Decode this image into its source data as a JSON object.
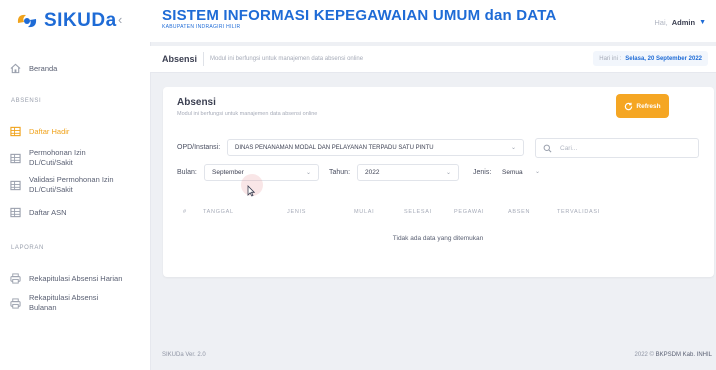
{
  "brand": {
    "logo_text": "SIKUDa",
    "collapse_icon": "chevron-left-icon"
  },
  "header": {
    "title": "SISTEM INFORMASI KEPEGAWAIAN UMUM dan DATA",
    "subtitle": "KABUPATEN INDRAGIRI HILIR",
    "user_greeting": "Hai,",
    "user_name": "Admin"
  },
  "sidebar": {
    "home": {
      "label": "Beranda",
      "icon": "home-icon"
    },
    "section_absensi": "ABSENSI",
    "absensi_items": [
      {
        "label": "Daftar Hadir",
        "icon": "table-icon",
        "active": true
      },
      {
        "label": "Permohonan Izin DL/Cuti/Sakit",
        "icon": "table-icon",
        "active": false
      },
      {
        "label": "Validasi Permohonan Izin DL/Cuti/Sakit",
        "icon": "table-icon",
        "active": false
      },
      {
        "label": "Daftar ASN",
        "icon": "table-icon",
        "active": false
      }
    ],
    "section_laporan": "LAPORAN",
    "laporan_items": [
      {
        "label": "Rekapitulasi Absensi Harian",
        "icon": "printer-icon"
      },
      {
        "label": "Rekapitulasi Absensi Bulanan",
        "icon": "printer-icon"
      }
    ]
  },
  "subheader": {
    "title": "Absensi",
    "description": "Modul ini berfungsi untuk manajemen data absensi online",
    "date_label": "Hari ini :",
    "date_value": "Selasa, 20 September 2022"
  },
  "card": {
    "title": "Absensi",
    "description": "Modul ini berfungsi untuk manajemen data absensi online",
    "refresh_label": "Refresh",
    "filters": {
      "opd_label": "OPD/Instansi:",
      "opd_value": "DINAS PENANAMAN MODAL DAN PELAYANAN TERPADU SATU PINTU",
      "search_placeholder": "Cari...",
      "bulan_label": "Bulan:",
      "bulan_value": "September",
      "tahun_label": "Tahun:",
      "tahun_value": "2022",
      "jenis_label": "Jenis:",
      "jenis_value": "Semua"
    },
    "table": {
      "columns": [
        "#",
        "TANGGAL",
        "JENIS",
        "MULAI",
        "SELESAI",
        "PEGAWAI",
        "ABSEN",
        "TERVALIDASI"
      ],
      "empty_text": "Tidak ada data yang ditemukan"
    }
  },
  "footer": {
    "version": "SIKUDa Ver. 2.0",
    "copyright": "2022 ©",
    "org": "BKPSDM Kab. INHIL"
  },
  "colors": {
    "primary": "#1e6bd6",
    "accent": "#f5a623",
    "active_nav": "#f0a31c"
  }
}
